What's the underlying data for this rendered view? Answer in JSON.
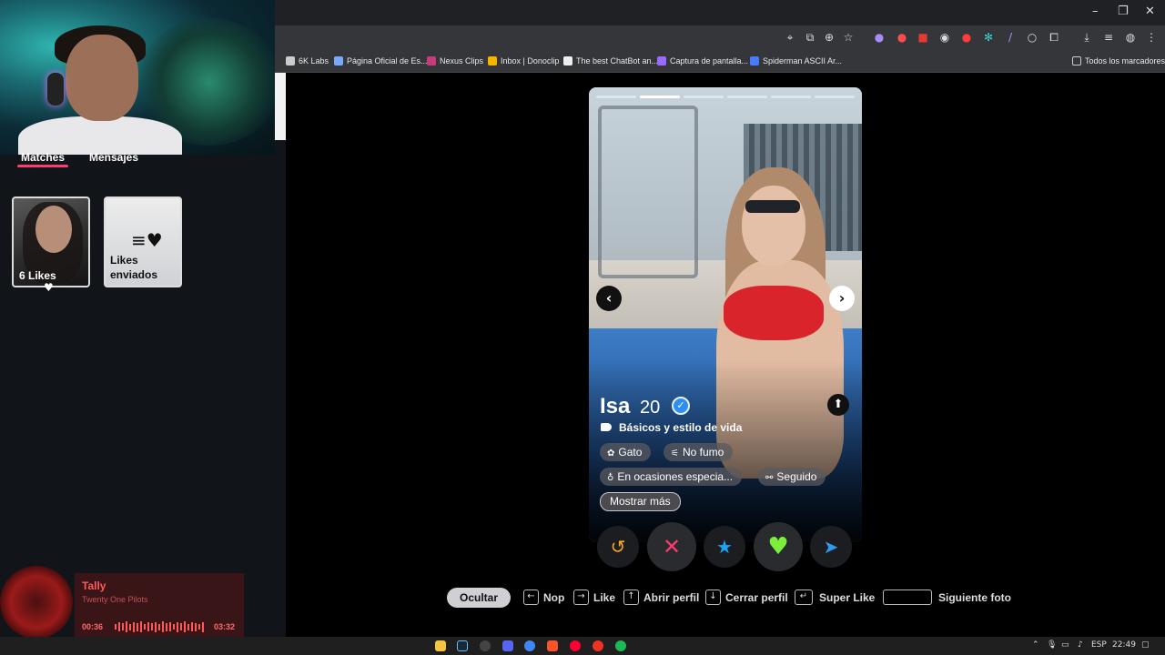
{
  "browser": {
    "window_controls": {
      "minimize": "–",
      "restore": "❐",
      "close": "✕"
    },
    "bookmarks": [
      {
        "label": "6K Labs",
        "color": "#cccccc"
      },
      {
        "label": "Página Oficial de Es...",
        "color": "#7aa7ff"
      },
      {
        "label": "Nexus Clips",
        "color": "#c83a7a"
      },
      {
        "label": "Inbox | Donoclip",
        "color": "#f5b400"
      },
      {
        "label": "The best ChatBot an...",
        "color": "#eeeeee"
      },
      {
        "label": "Captura de pantalla...",
        "color": "#9b6bff"
      },
      {
        "label": "Spiderman ASCII Ar...",
        "color": "#4a7bff"
      }
    ],
    "all_bookmarks": "Todos los marcadores"
  },
  "sidebar": {
    "tabs": {
      "matches": "Matches",
      "messages": "Mensajes"
    },
    "likes_card": {
      "label": "6 Likes",
      "badge": "♥"
    },
    "sent_card": {
      "label_line1": "Likes",
      "label_line2": "enviados",
      "icon": "heart-speed-icon"
    }
  },
  "music": {
    "title": "Tally",
    "artist": "Twenty One Pilots",
    "elapsed": "00:36",
    "duration": "03:32",
    "accent": "#ff5a5a"
  },
  "profile": {
    "name": "Isa",
    "age": "20",
    "verified": "✓",
    "section": "Básicos y estilo de vida",
    "chips": {
      "pet": "Gato",
      "smoking": "No fumo",
      "drinking": "En ocasiones especia...",
      "social": "Seguido"
    },
    "show_more": "Mostrar más",
    "photos_total": 6,
    "photo_active_index": 2
  },
  "actions": {
    "rewind": "↺",
    "nope": "✕",
    "super_like": "★",
    "like": "♥",
    "boost": "➤"
  },
  "shortcuts": {
    "hide": "Ocultar",
    "nope": "Nop",
    "like": "Like",
    "open_profile": "Abrir perfil",
    "close_profile": "Cerrar perfil",
    "super_like": "Super Like",
    "next_photo": "Siguiente foto"
  },
  "taskbar": {
    "lang": "ESP",
    "time": "22:49"
  },
  "colors": {
    "tinder_pink": "#fe3c72",
    "like_green": "#7bef3c",
    "super_blue": "#1ca4f4",
    "rewind_gold": "#f5a623"
  }
}
